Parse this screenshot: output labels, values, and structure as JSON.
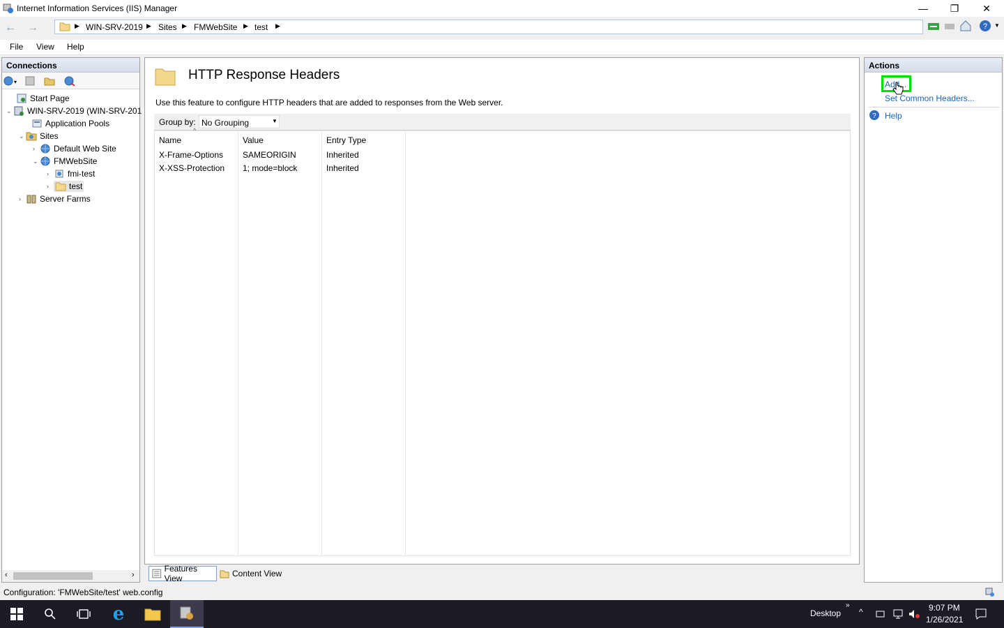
{
  "window": {
    "title": "Internet Information Services (IIS) Manager",
    "minimize": "—",
    "restore": "❐",
    "close": "✕"
  },
  "address": {
    "crumbs": [
      "WIN-SRV-2019",
      "Sites",
      "FMWebSite",
      "test"
    ],
    "separator": "▶"
  },
  "menu": {
    "file": "File",
    "view": "View",
    "help": "Help"
  },
  "connections": {
    "header": "Connections",
    "tree": [
      {
        "label": "Start Page"
      },
      {
        "label": "WIN-SRV-2019 (WIN-SRV-201"
      },
      {
        "label": "Application Pools"
      },
      {
        "label": "Sites"
      },
      {
        "label": "Default Web Site"
      },
      {
        "label": "FMWebSite"
      },
      {
        "label": "fmi-test"
      },
      {
        "label": "test"
      },
      {
        "label": "Server Farms"
      }
    ]
  },
  "feature": {
    "title": "HTTP Response Headers",
    "description": "Use this feature to configure HTTP headers that are added to responses from the Web server.",
    "group_by_label": "Group by:",
    "group_by_value": "No Grouping",
    "columns": [
      "Name",
      "Value",
      "Entry Type"
    ],
    "rows": [
      [
        "X-Frame-Options",
        "SAMEORIGIN",
        "Inherited"
      ],
      [
        "X-XSS-Protection",
        "1; mode=block",
        "Inherited"
      ]
    ]
  },
  "view_tabs": {
    "features": "Features View",
    "content": "Content View"
  },
  "actions": {
    "header": "Actions",
    "add": "Add...",
    "set_common": "Set Common Headers...",
    "help": "Help"
  },
  "status": {
    "text": "Configuration: 'FMWebSite/test' web.config"
  },
  "taskbar": {
    "desktop": "Desktop",
    "time": "9:07 PM",
    "date": "1/26/2021"
  },
  "colors": {
    "highlight": "#00e000",
    "link": "#1a66b8",
    "taskbar": "#1b1b26"
  }
}
